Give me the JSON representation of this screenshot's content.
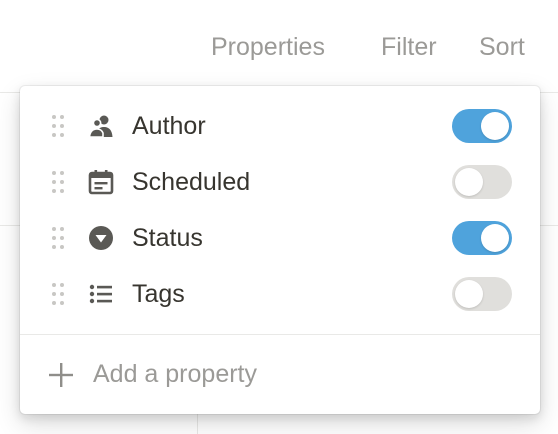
{
  "toolbar": {
    "properties_label": "Properties",
    "filter_label": "Filter",
    "sort_label": "Sort"
  },
  "properties_menu": {
    "items": [
      {
        "label": "Author",
        "icon": "person-icon",
        "visible": true
      },
      {
        "label": "Scheduled",
        "icon": "calendar-icon",
        "visible": false
      },
      {
        "label": "Status",
        "icon": "select-icon",
        "visible": true
      },
      {
        "label": "Tags",
        "icon": "multi-select-icon",
        "visible": false
      }
    ],
    "add_property_label": "Add a property"
  },
  "colors": {
    "toggle_on": "#4fa3dc",
    "toggle_off": "#e0dfdc",
    "muted_text": "#9b9a97",
    "text": "#37352f"
  }
}
